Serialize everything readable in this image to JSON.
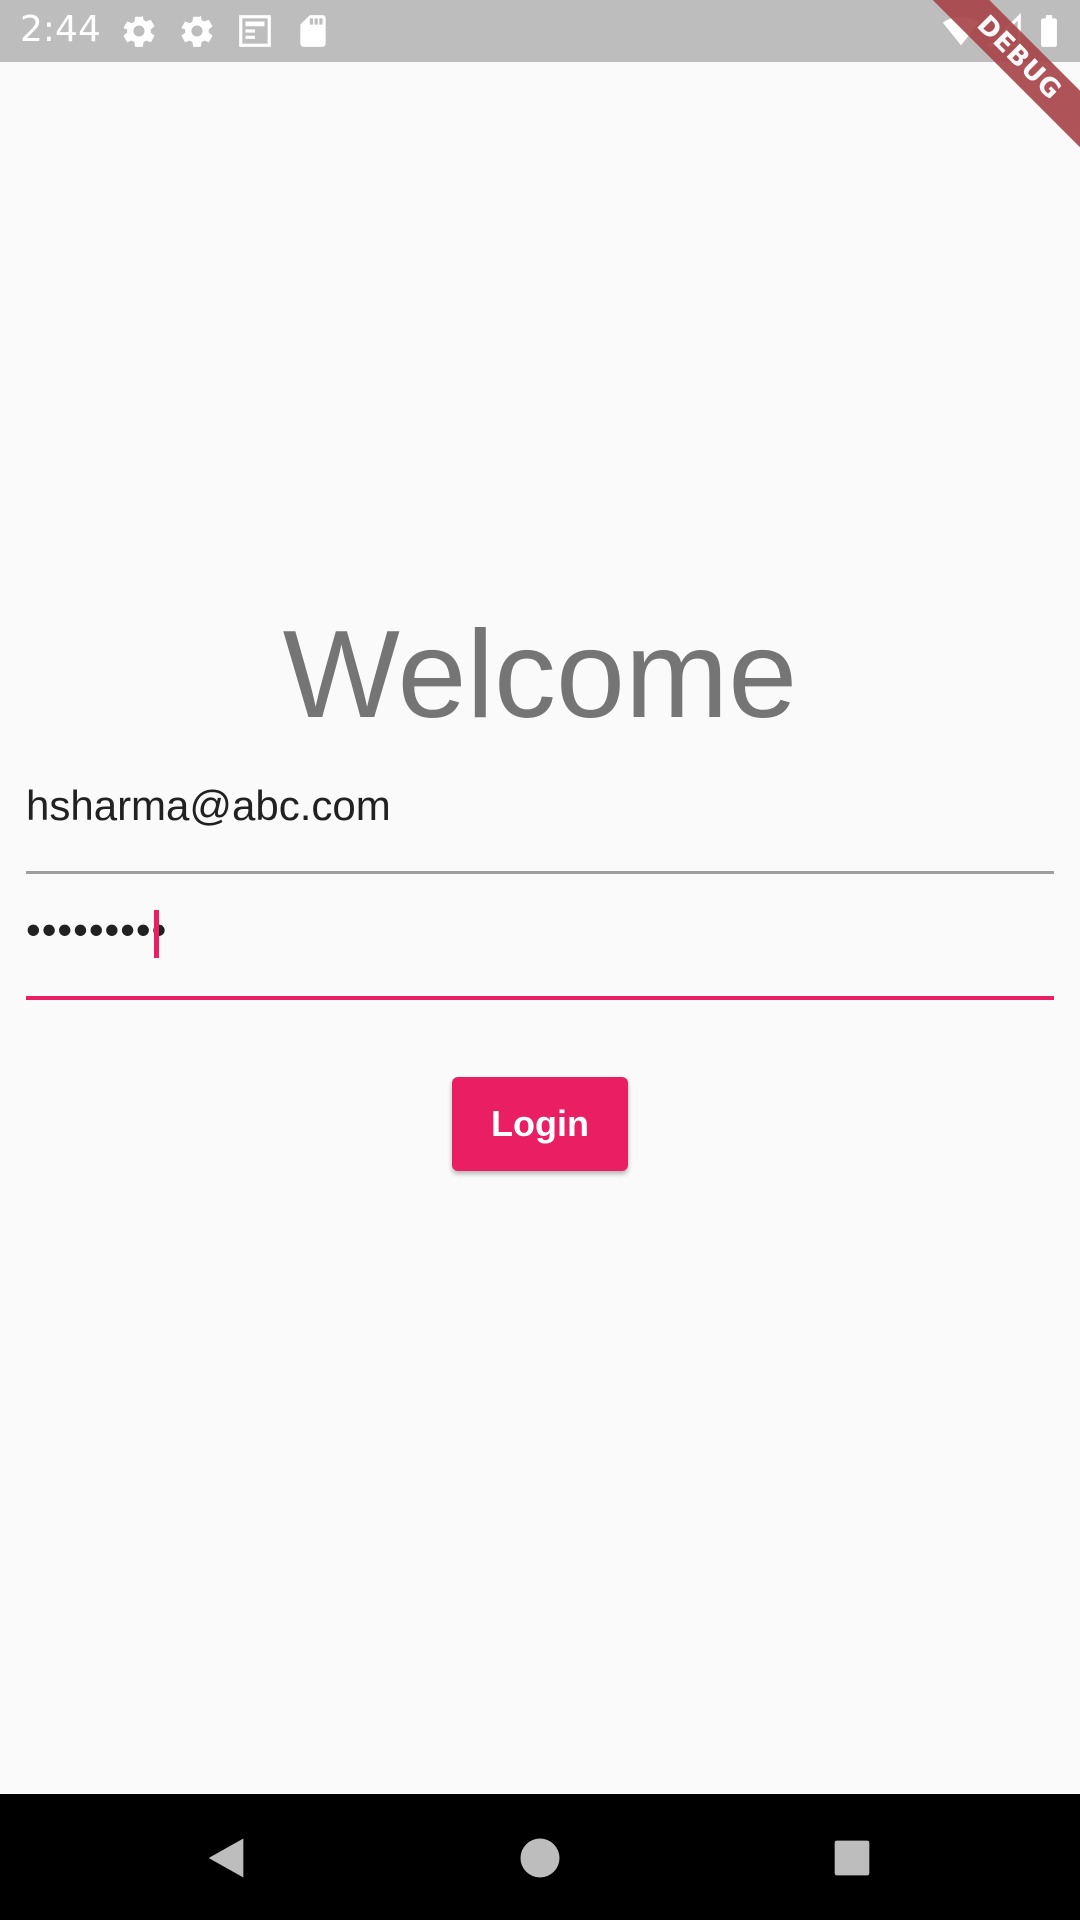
{
  "status_bar": {
    "time": "2:44",
    "left_icons": [
      "gear-icon",
      "gear-icon",
      "news-icon",
      "sd-card-icon"
    ],
    "right_icons": [
      "wifi-icon",
      "signal-icon",
      "battery-icon"
    ]
  },
  "debug_banner": {
    "label": "DEBUG"
  },
  "login": {
    "title": "Welcome",
    "email_value": "hsharma@abc.com",
    "password_value": "•••••••••",
    "button_label": "Login"
  },
  "colors": {
    "accent": "#e91e63",
    "status_bar": "#bdbdbd",
    "title_text": "#757575",
    "background": "#fafafa"
  },
  "nav_bar": {
    "buttons": [
      "back-icon",
      "home-icon",
      "recents-icon"
    ]
  }
}
